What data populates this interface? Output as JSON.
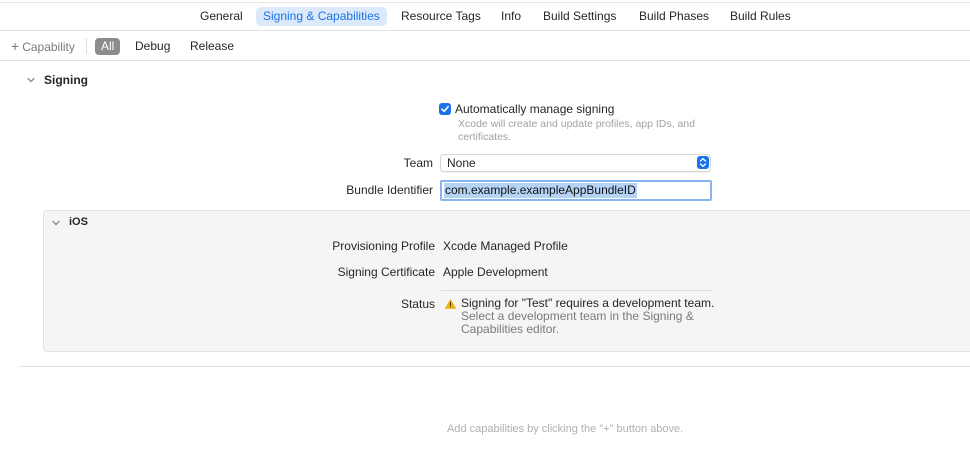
{
  "tabs": [
    {
      "label": "General",
      "active": false
    },
    {
      "label": "Signing & Capabilities",
      "active": true
    },
    {
      "label": "Resource Tags",
      "active": false
    },
    {
      "label": "Info",
      "active": false
    },
    {
      "label": "Build Settings",
      "active": false
    },
    {
      "label": "Build Phases",
      "active": false
    },
    {
      "label": "Build Rules",
      "active": false
    }
  ],
  "filterbar": {
    "add_capability": "Capability",
    "add_icon": "plus-icon",
    "configs": [
      "All",
      "Debug",
      "Release"
    ],
    "selected_config": "All"
  },
  "signing": {
    "title": "Signing",
    "auto_manage_label": "Automatically manage signing",
    "auto_manage_checked": true,
    "auto_manage_hint_line1": "Xcode will create and update profiles, app IDs, and",
    "auto_manage_hint_line2": "certificates.",
    "team_label": "Team",
    "team_value": "None",
    "bundle_label": "Bundle Identifier",
    "bundle_value": "com.example.exampleAppBundleID"
  },
  "ios": {
    "title": "iOS",
    "profile_label": "Provisioning Profile",
    "profile_value": "Xcode Managed Profile",
    "cert_label": "Signing Certificate",
    "cert_value": "Apple Development",
    "status_label": "Status",
    "status_primary": "Signing for \"Test\" requires a development team.",
    "status_secondary": "Select a development team in the Signing & Capabilities editor.",
    "status_icon": "warning-icon"
  },
  "empty_hint": "Add capabilities by clicking the \"+\" button above.",
  "colors": {
    "accent": "#1a73e8",
    "tab_active_bg": "#dce9fb",
    "warning": "#f5b400"
  }
}
